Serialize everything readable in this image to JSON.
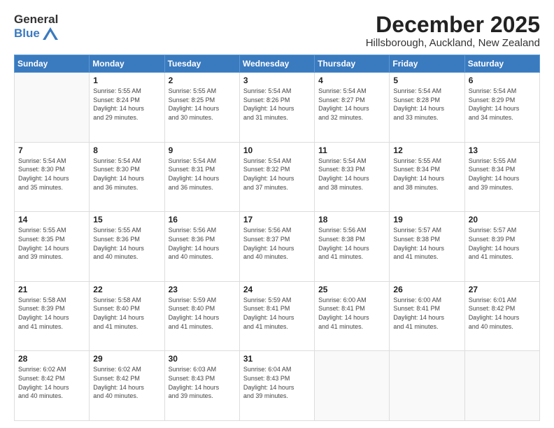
{
  "header": {
    "logo_line1": "General",
    "logo_line2": "Blue",
    "title": "December 2025",
    "subtitle": "Hillsborough, Auckland, New Zealand"
  },
  "calendar": {
    "days_of_week": [
      "Sunday",
      "Monday",
      "Tuesday",
      "Wednesday",
      "Thursday",
      "Friday",
      "Saturday"
    ],
    "weeks": [
      [
        {
          "day": "",
          "info": ""
        },
        {
          "day": "1",
          "info": "Sunrise: 5:55 AM\nSunset: 8:24 PM\nDaylight: 14 hours\nand 29 minutes."
        },
        {
          "day": "2",
          "info": "Sunrise: 5:55 AM\nSunset: 8:25 PM\nDaylight: 14 hours\nand 30 minutes."
        },
        {
          "day": "3",
          "info": "Sunrise: 5:54 AM\nSunset: 8:26 PM\nDaylight: 14 hours\nand 31 minutes."
        },
        {
          "day": "4",
          "info": "Sunrise: 5:54 AM\nSunset: 8:27 PM\nDaylight: 14 hours\nand 32 minutes."
        },
        {
          "day": "5",
          "info": "Sunrise: 5:54 AM\nSunset: 8:28 PM\nDaylight: 14 hours\nand 33 minutes."
        },
        {
          "day": "6",
          "info": "Sunrise: 5:54 AM\nSunset: 8:29 PM\nDaylight: 14 hours\nand 34 minutes."
        }
      ],
      [
        {
          "day": "7",
          "info": "Sunrise: 5:54 AM\nSunset: 8:30 PM\nDaylight: 14 hours\nand 35 minutes."
        },
        {
          "day": "8",
          "info": "Sunrise: 5:54 AM\nSunset: 8:30 PM\nDaylight: 14 hours\nand 36 minutes."
        },
        {
          "day": "9",
          "info": "Sunrise: 5:54 AM\nSunset: 8:31 PM\nDaylight: 14 hours\nand 36 minutes."
        },
        {
          "day": "10",
          "info": "Sunrise: 5:54 AM\nSunset: 8:32 PM\nDaylight: 14 hours\nand 37 minutes."
        },
        {
          "day": "11",
          "info": "Sunrise: 5:54 AM\nSunset: 8:33 PM\nDaylight: 14 hours\nand 38 minutes."
        },
        {
          "day": "12",
          "info": "Sunrise: 5:55 AM\nSunset: 8:34 PM\nDaylight: 14 hours\nand 38 minutes."
        },
        {
          "day": "13",
          "info": "Sunrise: 5:55 AM\nSunset: 8:34 PM\nDaylight: 14 hours\nand 39 minutes."
        }
      ],
      [
        {
          "day": "14",
          "info": "Sunrise: 5:55 AM\nSunset: 8:35 PM\nDaylight: 14 hours\nand 39 minutes."
        },
        {
          "day": "15",
          "info": "Sunrise: 5:55 AM\nSunset: 8:36 PM\nDaylight: 14 hours\nand 40 minutes."
        },
        {
          "day": "16",
          "info": "Sunrise: 5:56 AM\nSunset: 8:36 PM\nDaylight: 14 hours\nand 40 minutes."
        },
        {
          "day": "17",
          "info": "Sunrise: 5:56 AM\nSunset: 8:37 PM\nDaylight: 14 hours\nand 40 minutes."
        },
        {
          "day": "18",
          "info": "Sunrise: 5:56 AM\nSunset: 8:38 PM\nDaylight: 14 hours\nand 41 minutes."
        },
        {
          "day": "19",
          "info": "Sunrise: 5:57 AM\nSunset: 8:38 PM\nDaylight: 14 hours\nand 41 minutes."
        },
        {
          "day": "20",
          "info": "Sunrise: 5:57 AM\nSunset: 8:39 PM\nDaylight: 14 hours\nand 41 minutes."
        }
      ],
      [
        {
          "day": "21",
          "info": "Sunrise: 5:58 AM\nSunset: 8:39 PM\nDaylight: 14 hours\nand 41 minutes."
        },
        {
          "day": "22",
          "info": "Sunrise: 5:58 AM\nSunset: 8:40 PM\nDaylight: 14 hours\nand 41 minutes."
        },
        {
          "day": "23",
          "info": "Sunrise: 5:59 AM\nSunset: 8:40 PM\nDaylight: 14 hours\nand 41 minutes."
        },
        {
          "day": "24",
          "info": "Sunrise: 5:59 AM\nSunset: 8:41 PM\nDaylight: 14 hours\nand 41 minutes."
        },
        {
          "day": "25",
          "info": "Sunrise: 6:00 AM\nSunset: 8:41 PM\nDaylight: 14 hours\nand 41 minutes."
        },
        {
          "day": "26",
          "info": "Sunrise: 6:00 AM\nSunset: 8:41 PM\nDaylight: 14 hours\nand 41 minutes."
        },
        {
          "day": "27",
          "info": "Sunrise: 6:01 AM\nSunset: 8:42 PM\nDaylight: 14 hours\nand 40 minutes."
        }
      ],
      [
        {
          "day": "28",
          "info": "Sunrise: 6:02 AM\nSunset: 8:42 PM\nDaylight: 14 hours\nand 40 minutes."
        },
        {
          "day": "29",
          "info": "Sunrise: 6:02 AM\nSunset: 8:42 PM\nDaylight: 14 hours\nand 40 minutes."
        },
        {
          "day": "30",
          "info": "Sunrise: 6:03 AM\nSunset: 8:43 PM\nDaylight: 14 hours\nand 39 minutes."
        },
        {
          "day": "31",
          "info": "Sunrise: 6:04 AM\nSunset: 8:43 PM\nDaylight: 14 hours\nand 39 minutes."
        },
        {
          "day": "",
          "info": ""
        },
        {
          "day": "",
          "info": ""
        },
        {
          "day": "",
          "info": ""
        }
      ]
    ]
  }
}
